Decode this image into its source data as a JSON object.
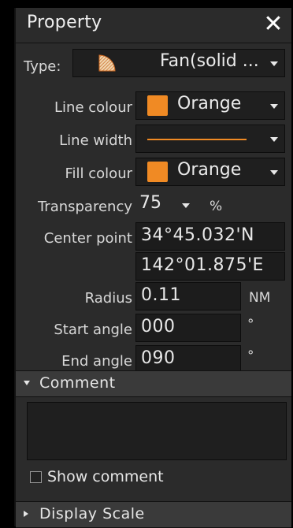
{
  "title": "Property",
  "type": {
    "label": "Type:",
    "value": "Fan(solid ...",
    "icon": "fan-solid-icon"
  },
  "line_colour": {
    "label": "Line colour",
    "value": "Orange",
    "color": "#f08a24"
  },
  "line_width": {
    "label": "Line width"
  },
  "fill_colour": {
    "label": "Fill colour",
    "value": "Orange",
    "color": "#f08a24"
  },
  "transparency": {
    "label": "Transparency",
    "value": "75",
    "unit": "%"
  },
  "center_point": {
    "label": "Center point",
    "lat": "34°45.032'N",
    "lon": "142°01.875'E"
  },
  "radius": {
    "label": "Radius",
    "value": "0.11",
    "unit": "NM"
  },
  "start_angle": {
    "label": "Start angle",
    "value": "000",
    "unit": "°"
  },
  "end_angle": {
    "label": "End angle",
    "value": "090",
    "unit": "°"
  },
  "comment": {
    "section_label": "Comment",
    "text": "",
    "show_label": "Show comment",
    "show_checked": false
  },
  "display_scale": {
    "section_label": "Display Scale"
  }
}
